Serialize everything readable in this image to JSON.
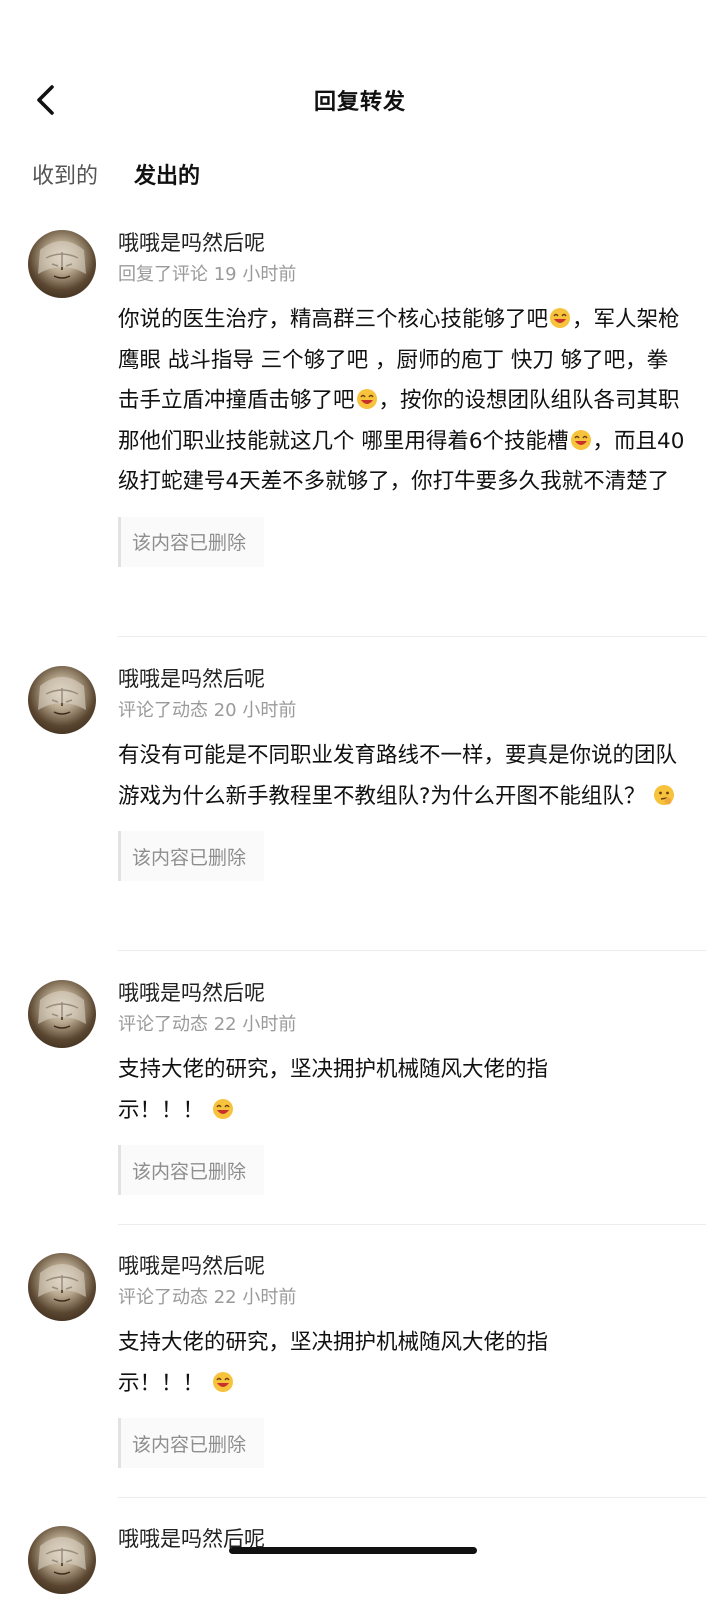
{
  "header": {
    "title": "回复转发"
  },
  "tabs": [
    {
      "label": "收到的",
      "active": false
    },
    {
      "label": "发出的",
      "active": true
    }
  ],
  "items": [
    {
      "name": "哦哦是吗然后呢",
      "meta": "回复了评论 19 小时前",
      "body_parts": [
        "你说的医生治疗，精高群三个核心技能够了吧",
        "，军人架枪 鹰眼 战斗指导 三个够了吧 ，厨师的庖丁 快刀 够了吧，拳击手立盾冲撞盾击够了吧",
        "，按你的设想团队组队各司其职那他们职业技能就这几个 哪里用得着6个技能槽",
        "，而且40级打蛇建号4天差不多就够了，你打牛要多久我就不清楚了"
      ],
      "quote": "该内容已删除"
    },
    {
      "name": "哦哦是吗然后呢",
      "meta": "评论了动态 20 小时前",
      "body_parts": [
        "有没有可能是不同职业发育路线不一样，要真是你说的团队游戏为什么新手教程里不教组队?为什么开图不能组队？ "
      ],
      "quote": "该内容已删除"
    },
    {
      "name": "哦哦是吗然后呢",
      "meta": "评论了动态 22 小时前",
      "body_parts": [
        "支持大佬的研究，坚决拥护机械随风大佬的指",
        "示！！！ "
      ],
      "quote": "该内容已删除"
    },
    {
      "name": "哦哦是吗然后呢",
      "meta": "评论了动态 22 小时前",
      "body_parts": [
        "支持大佬的研究，坚决拥护机械随风大佬的指",
        "示！！！ "
      ],
      "quote": "该内容已删除"
    },
    {
      "name": "哦哦是吗然后呢"
    }
  ],
  "colors": {
    "accent": "#27c4c8",
    "meta": "#9a9a9a",
    "divider": "#ececec"
  }
}
